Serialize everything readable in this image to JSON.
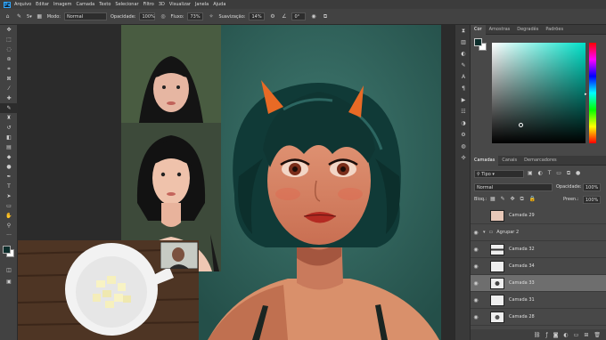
{
  "app": {
    "logo": "Ps"
  },
  "menu": [
    "Arquivo",
    "Editar",
    "Imagem",
    "Camada",
    "Texto",
    "Selecionar",
    "Filtro",
    "3D",
    "Visualizar",
    "Janela",
    "Ajuda"
  ],
  "options": {
    "mode_label": "Modo:",
    "mode_value": "Normal",
    "opacity_label": "Opacidade:",
    "opacity_value": "100%",
    "flow_label": "Fluxo:",
    "flow_value": "73%",
    "smoothing_label": "Suavização:",
    "smoothing_value": "14%",
    "angle_value": "0°",
    "brush_size": "5"
  },
  "color_panel": {
    "tabs": [
      "Cor",
      "Amostras",
      "Degradês",
      "Padrões"
    ],
    "active_tab": "Cor",
    "foreground": "#0d2e2c",
    "background": "#ffffff",
    "hue_color": "#00e0c8"
  },
  "layers_panel": {
    "tabs": [
      "Camadas",
      "Canais",
      "Demarcadores"
    ],
    "filter_value": "Tipo",
    "blend_mode": "Normal",
    "opacity_label": "Opacidade:",
    "opacity_value": "100%",
    "lock_label": "Bloq.:",
    "fill_label": "Preen.:",
    "fill_value": "100%",
    "layers": [
      {
        "name": "Camada 29",
        "visible": false,
        "selected": false,
        "group": false
      },
      {
        "name": "Agrupar 2",
        "visible": true,
        "selected": false,
        "group": true
      },
      {
        "name": "Camada 32",
        "visible": true,
        "selected": false,
        "group": false
      },
      {
        "name": "Camada 34",
        "visible": true,
        "selected": false,
        "group": false
      },
      {
        "name": "Camada 33",
        "visible": true,
        "selected": true,
        "group": false
      },
      {
        "name": "Camada 31",
        "visible": true,
        "selected": false,
        "group": false
      },
      {
        "name": "Camada 28",
        "visible": true,
        "selected": false,
        "group": false
      }
    ]
  }
}
